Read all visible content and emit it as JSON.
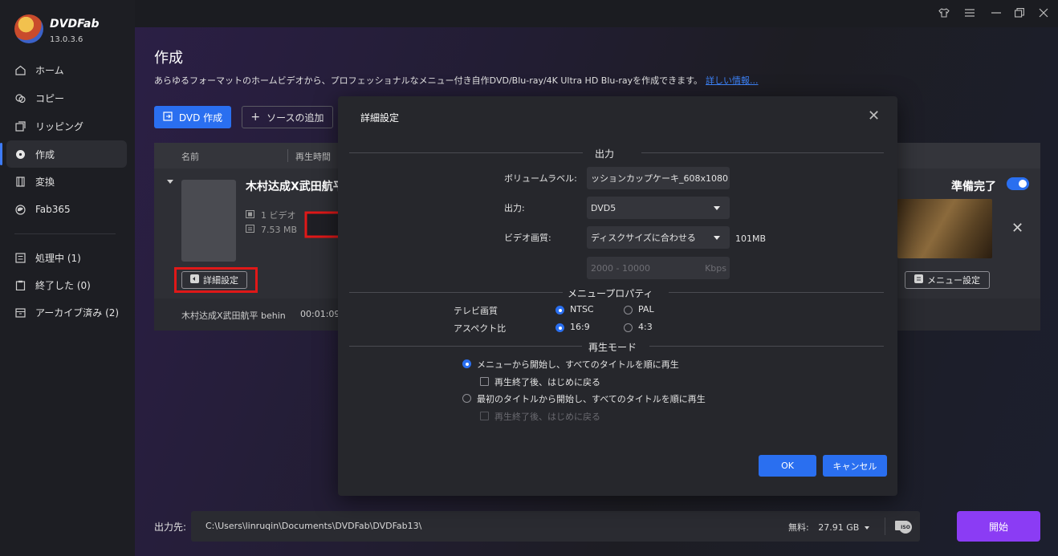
{
  "app": {
    "brand": "DVDFab",
    "version": "13.0.3.6"
  },
  "sidebar": {
    "items": [
      {
        "label": "ホーム",
        "icon": "home-icon"
      },
      {
        "label": "コピー",
        "icon": "copy-icon"
      },
      {
        "label": "リッピング",
        "icon": "ripper-icon"
      },
      {
        "label": "作成",
        "icon": "disc-icon"
      },
      {
        "label": "変換",
        "icon": "film-icon"
      },
      {
        "label": "Fab365",
        "icon": "fab365-icon"
      }
    ],
    "queue": [
      {
        "label": "処理中 (1)",
        "icon": "list-icon"
      },
      {
        "label": "終了した (0)",
        "icon": "clipboard-icon"
      },
      {
        "label": "アーカイブ済み (2)",
        "icon": "archive-icon"
      }
    ]
  },
  "main": {
    "title": "作成",
    "description": "あらゆるフォーマットのホームビデオから、プロフェッショナルなメニュー付き自作DVD/Blu-ray/4K Ultra HD Blu-rayを作成できます。",
    "link": "詳しい情報...",
    "dvd_button": "DVD 作成",
    "add_source_button": "ソースの追加"
  },
  "list": {
    "col_name": "名前",
    "col_duration": "再生時間",
    "item_title": "木村达成X武田航平",
    "video_count": "1 ビデオ",
    "size": "7.53 MB",
    "detail_button": "詳細設定",
    "status": "準備完了",
    "menu_button": "メニュー設定",
    "sub_name": "木村达成X武田航平 behin",
    "sub_duration": "00:01:09"
  },
  "bottom": {
    "output_label": "出力先:",
    "path": "C:\\Users\\linruqin\\Documents\\DVDFab\\DVDFab13\\",
    "free_label": "無料:",
    "free_value": "27.91 GB",
    "iso_label": "ISO",
    "start_button": "開始"
  },
  "modal": {
    "title": "詳細設定",
    "section_output": "出力",
    "volume_label_label": "ボリュームラベル:",
    "volume_label_value": "ッションカップケーキ_608x1080",
    "output_label": "出力:",
    "output_value": "DVD5",
    "quality_label": "ビデオ画質:",
    "quality_value": "ディスクサイズに合わせる",
    "quality_size": "101MB",
    "bitrate_placeholder": "2000 - 10000",
    "bitrate_unit": "Kbps",
    "section_menu": "メニュープロパティ",
    "tv_label": "テレビ画質",
    "tv_options": [
      "NTSC",
      "PAL"
    ],
    "aspect_label": "アスペクト比",
    "aspect_options": [
      "16:9",
      "4:3"
    ],
    "section_playback": "再生モード",
    "play_opt1": "メニューから開始し、すべてのタイトルを順に再生",
    "play_opt1_sub": "再生終了後、はじめに戻る",
    "play_opt2": "最初のタイトルから開始し、すべてのタイトルを順に再生",
    "play_opt2_sub": "再生終了後、はじめに戻る",
    "ok_button": "OK",
    "cancel_button": "キャンセル"
  },
  "colors": {
    "accent_blue": "#2a6ff0",
    "start_purple": "#8b3cf4",
    "highlight_red": "#e01818"
  }
}
